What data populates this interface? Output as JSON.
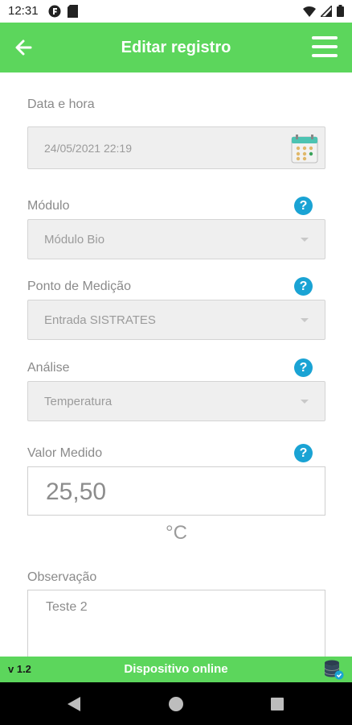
{
  "status_bar": {
    "time": "12:31"
  },
  "app_bar": {
    "title": "Editar registro"
  },
  "fields": {
    "datetime": {
      "label": "Data e hora",
      "value": "24/05/2021 22:19"
    },
    "module": {
      "label": "Módulo",
      "value": "Módulo Bio"
    },
    "measure_point": {
      "label": "Ponto de Medição",
      "value": "Entrada SISTRATES"
    },
    "analysis": {
      "label": "Análise",
      "value": "Temperatura"
    },
    "measured_value": {
      "label": "Valor Medido",
      "value": "25,50",
      "unit": "°C"
    },
    "observation": {
      "label": "Observação",
      "value": "Teste 2"
    }
  },
  "help_icon_glyph": "?",
  "footer": {
    "version": "v 1.2",
    "status": "Dispositivo online"
  },
  "colors": {
    "primary": "#5cd65c",
    "help": "#1aa3d4",
    "nav": "#000000"
  },
  "icons": [
    "back-arrow-icon",
    "hamburger-menu-icon",
    "calendar-icon",
    "help-icon",
    "dropdown-caret-icon",
    "database-online-icon"
  ]
}
